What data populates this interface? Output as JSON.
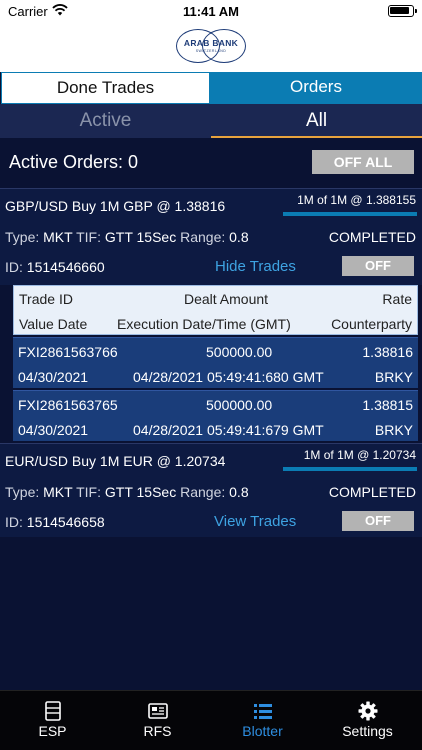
{
  "status_bar": {
    "carrier": "Carrier",
    "time": "11:41 AM"
  },
  "logo": {
    "name": "ARAB BANK",
    "sub": "SWITZERLAND"
  },
  "top_tabs": [
    {
      "label": "Done Trades"
    },
    {
      "label": "Orders"
    }
  ],
  "filter_tabs": [
    {
      "label": "Active"
    },
    {
      "label": "All"
    }
  ],
  "active_orders": {
    "label": "Active Orders: 0",
    "off_all": "OFF ALL"
  },
  "orders": [
    {
      "pair": "GBP/USD Buy 1M GBP @ 1.38816",
      "fill": "1M of 1M @ 1.388155",
      "fill_percent": 100,
      "type_label": "Type:",
      "type": "MKT",
      "tif_label": "TIF:",
      "tif": "GTT 15Sec",
      "range_label": "Range:",
      "range": "0.8",
      "status": "COMPLETED",
      "id_label": "ID:",
      "id": "1514546660",
      "trades_link": "Hide Trades",
      "off": "OFF"
    },
    {
      "pair": "EUR/USD Buy 1M EUR @ 1.20734",
      "fill": "1M of 1M @ 1.20734",
      "fill_percent": 100,
      "type_label": "Type:",
      "type": "MKT",
      "tif_label": "TIF:",
      "tif": "GTT 15Sec",
      "range_label": "Range:",
      "range": "0.8",
      "status": "COMPLETED",
      "id_label": "ID:",
      "id": "1514546658",
      "trades_link": "View Trades",
      "off": "OFF"
    }
  ],
  "trades_table": {
    "headers": {
      "trade_id": "Trade ID",
      "dealt_amount": "Dealt Amount",
      "rate": "Rate",
      "value_date": "Value Date",
      "execution": "Execution Date/Time (GMT)",
      "counterparty": "Counterparty"
    },
    "rows": [
      {
        "trade_id": "FXI2861563766",
        "dealt_amount": "500000.00",
        "rate": "1.38816",
        "value_date": "04/30/2021",
        "execution": "04/28/2021 05:49:41:680 GMT",
        "counterparty": "BRKY"
      },
      {
        "trade_id": "FXI2861563765",
        "dealt_amount": "500000.00",
        "rate": "1.38815",
        "value_date": "04/30/2021",
        "execution": "04/28/2021 05:49:41:679 GMT",
        "counterparty": "BRKY"
      }
    ]
  },
  "tab_bar": [
    {
      "label": "ESP",
      "icon": "list-document-icon"
    },
    {
      "label": "RFS",
      "icon": "newspaper-icon"
    },
    {
      "label": "Blotter",
      "icon": "bulleted-list-icon",
      "selected": true
    },
    {
      "label": "Settings",
      "icon": "gear-icon"
    }
  ],
  "colors": {
    "accent": "#0b7cb3",
    "link": "#3ea3e2",
    "underline": "#e8a33d",
    "background": "#0a1233"
  }
}
